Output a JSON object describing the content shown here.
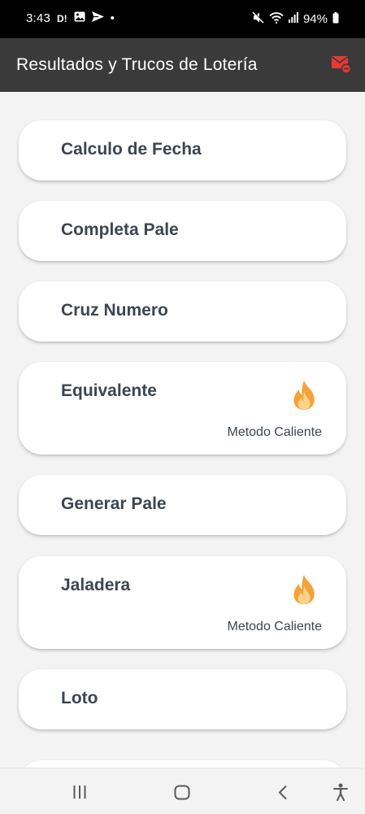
{
  "status_bar": {
    "time": "3:43",
    "left_marker": "D!",
    "dot": "•",
    "battery": "94%",
    "icons": [
      "gallery-icon",
      "send-icon",
      "mute-icon",
      "wifi-icon",
      "signal-icon",
      "battery-icon"
    ]
  },
  "app_bar": {
    "title": "Resultados y Trucos de Lotería",
    "mail_icon": "mail-notification-icon",
    "accent_color": "#e53935"
  },
  "cards": [
    {
      "title": "Calculo de Fecha",
      "subtitle": ""
    },
    {
      "title": "Completa Pale",
      "subtitle": ""
    },
    {
      "title": "Cruz Numero",
      "subtitle": ""
    },
    {
      "title": "Equivalente",
      "subtitle": "Metodo Caliente",
      "icon": "fire-icon"
    },
    {
      "title": "Generar Pale",
      "subtitle": ""
    },
    {
      "title": "Jaladera",
      "subtitle": "Metodo Caliente",
      "icon": "fire-icon"
    },
    {
      "title": "Loto",
      "subtitle": ""
    }
  ],
  "nav_bar": {
    "icons": [
      "recent-apps-icon",
      "home-icon",
      "back-icon",
      "accessibility-icon"
    ]
  }
}
